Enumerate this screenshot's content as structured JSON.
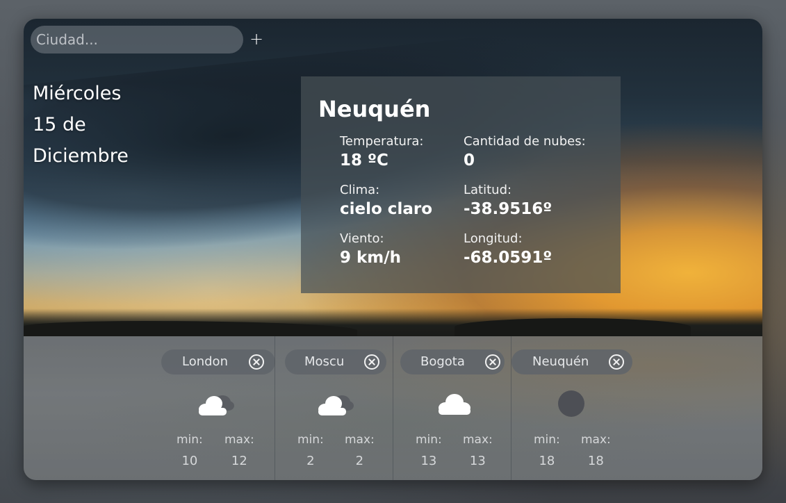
{
  "search": {
    "placeholder": "Ciudad..."
  },
  "add_label": "+",
  "date": {
    "weekday": "Miércoles",
    "day": "15 de",
    "month": "Diciembre"
  },
  "current": {
    "city": "Neuquén",
    "stats": [
      {
        "label": "Temperatura:",
        "value": "18 ºC"
      },
      {
        "label": "Cantidad de nubes:",
        "value": "0"
      },
      {
        "label": "Clima:",
        "value": "cielo claro"
      },
      {
        "label": "Latitud:",
        "value": "-38.9516º"
      },
      {
        "label": "Viento:",
        "value": "9 km/h"
      },
      {
        "label": "Longitud:",
        "value": "-68.0591º"
      }
    ]
  },
  "cities": [
    {
      "name": "London",
      "icon": "broken-clouds-icon",
      "min_label": "min:",
      "max_label": "max:",
      "min": "10",
      "max": "12"
    },
    {
      "name": "Moscu",
      "icon": "broken-clouds-icon",
      "min_label": "min:",
      "max_label": "max:",
      "min": "2",
      "max": "2"
    },
    {
      "name": "Bogota",
      "icon": "cloud-icon",
      "min_label": "min:",
      "max_label": "max:",
      "min": "13",
      "max": "13"
    },
    {
      "name": "Neuquén",
      "icon": "clear-night-icon",
      "min_label": "min:",
      "max_label": "max:",
      "min": "18",
      "max": "18"
    }
  ],
  "colors": {
    "panel": "#46505699",
    "chip": "#5f646a",
    "icon_light": "#ffffff",
    "icon_dark": "#5a5d62"
  }
}
